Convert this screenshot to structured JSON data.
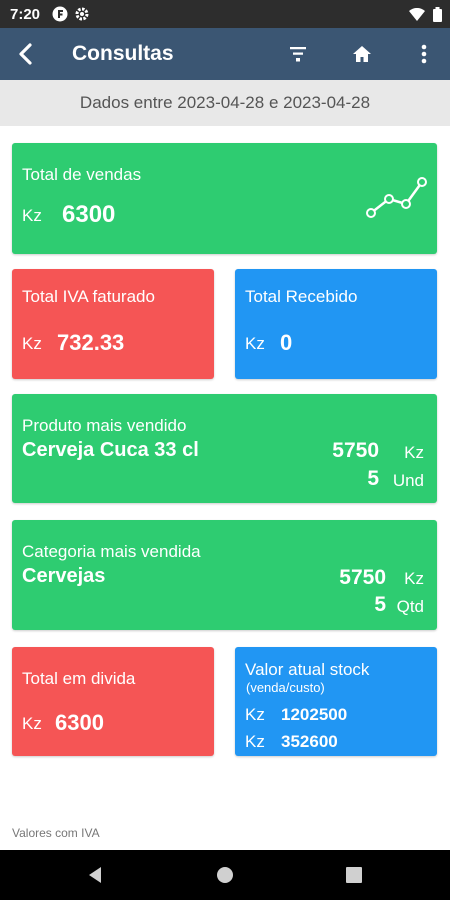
{
  "status_bar": {
    "time": "7:20",
    "icons": [
      "f-icon",
      "gear-icon",
      "wifi-icon",
      "battery-icon"
    ]
  },
  "app_bar": {
    "title": "Consultas",
    "actions": [
      "filter-icon",
      "home-icon",
      "more-vert-icon"
    ]
  },
  "date_range": "Dados entre 2023-04-28 e 2023-04-28",
  "total_vendas": {
    "title": "Total de vendas",
    "currency": "Kz",
    "value": "6300"
  },
  "total_iva": {
    "title": "Total IVA faturado",
    "currency": "Kz",
    "value": "732.33"
  },
  "total_recebido": {
    "title": "Total Recebido",
    "currency": "Kz",
    "value": "0"
  },
  "produto_mais_vendido": {
    "title": "Produto mais vendido",
    "name": "Cerveja Cuca 33 cl",
    "amount": "5750",
    "currency": "Kz",
    "qty": "5",
    "unit": "Und"
  },
  "categoria_mais_vendida": {
    "title": "Categoria mais vendida",
    "name": "Cervejas",
    "amount": "5750",
    "currency": "Kz",
    "qty": "5",
    "unit": "Qtd"
  },
  "total_divida": {
    "title": "Total em divida",
    "currency": "Kz",
    "value": "6300"
  },
  "valor_stock": {
    "title": "Valor atual stock",
    "subtitle": "(venda/custo)",
    "currency_1": "Kz",
    "venda": "1202500",
    "currency_2": "Kz",
    "custo": "352600"
  },
  "footer_note": "Valores com IVA",
  "colors": {
    "green": "#2ecc71",
    "red": "#f55555",
    "blue": "#2196f3",
    "app_bar": "#3b5673"
  }
}
